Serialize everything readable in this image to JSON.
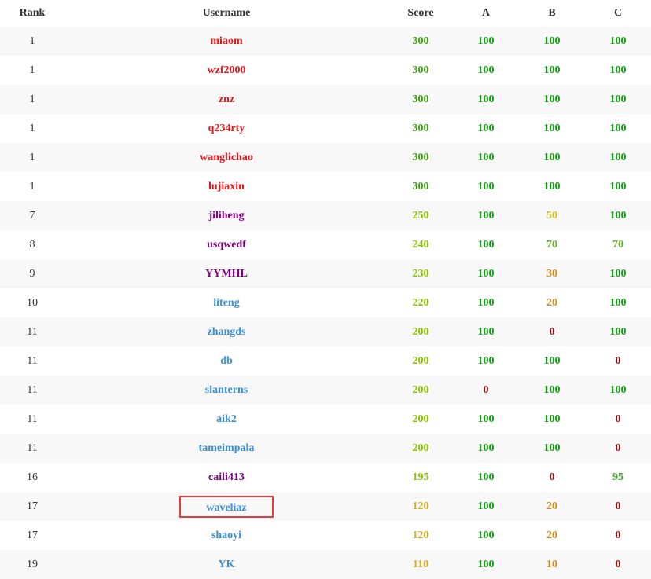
{
  "headers": {
    "rank": "Rank",
    "username": "Username",
    "score": "Score",
    "a": "A",
    "b": "B",
    "c": "C"
  },
  "rows": [
    {
      "rank": "1",
      "username": "miaom",
      "score": "300",
      "a": "100",
      "b": "100",
      "c": "100"
    },
    {
      "rank": "1",
      "username": "wzf2000",
      "score": "300",
      "a": "100",
      "b": "100",
      "c": "100"
    },
    {
      "rank": "1",
      "username": "znz",
      "score": "300",
      "a": "100",
      "b": "100",
      "c": "100"
    },
    {
      "rank": "1",
      "username": "q234rty",
      "score": "300",
      "a": "100",
      "b": "100",
      "c": "100"
    },
    {
      "rank": "1",
      "username": "wanglichao",
      "score": "300",
      "a": "100",
      "b": "100",
      "c": "100"
    },
    {
      "rank": "1",
      "username": "lujiaxin",
      "score": "300",
      "a": "100",
      "b": "100",
      "c": "100"
    },
    {
      "rank": "7",
      "username": "jiliheng",
      "score": "250",
      "a": "100",
      "b": "50",
      "c": "100"
    },
    {
      "rank": "8",
      "username": "usqwedf",
      "score": "240",
      "a": "100",
      "b": "70",
      "c": "70"
    },
    {
      "rank": "9",
      "username": "YYMHL",
      "score": "230",
      "a": "100",
      "b": "30",
      "c": "100"
    },
    {
      "rank": "10",
      "username": "liteng",
      "score": "220",
      "a": "100",
      "b": "20",
      "c": "100"
    },
    {
      "rank": "11",
      "username": "zhangds",
      "score": "200",
      "a": "100",
      "b": "0",
      "c": "100"
    },
    {
      "rank": "11",
      "username": "db",
      "score": "200",
      "a": "100",
      "b": "100",
      "c": "0"
    },
    {
      "rank": "11",
      "username": "slanterns",
      "score": "200",
      "a": "0",
      "b": "100",
      "c": "100"
    },
    {
      "rank": "11",
      "username": "aik2",
      "score": "200",
      "a": "100",
      "b": "100",
      "c": "0"
    },
    {
      "rank": "11",
      "username": "tameimpala",
      "score": "200",
      "a": "100",
      "b": "100",
      "c": "0"
    },
    {
      "rank": "16",
      "username": "caili413",
      "score": "195",
      "a": "100",
      "b": "0",
      "c": "95"
    },
    {
      "rank": "17",
      "username": "waveliaz",
      "score": "120",
      "a": "100",
      "b": "20",
      "c": "0"
    },
    {
      "rank": "17",
      "username": "shaoyi",
      "score": "120",
      "a": "100",
      "b": "20",
      "c": "0"
    },
    {
      "rank": "19",
      "username": "YK",
      "score": "110",
      "a": "100",
      "b": "10",
      "c": "0"
    }
  ]
}
